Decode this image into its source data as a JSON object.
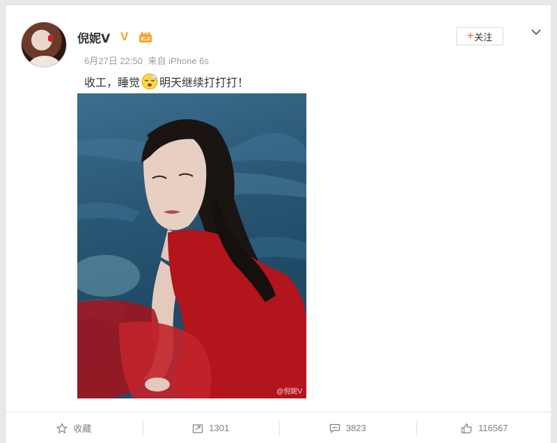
{
  "post": {
    "username": "倪妮V",
    "verified_badge": "V",
    "member_icon": "vip-crown-icon",
    "date": "6月27日 22:50",
    "source": "来自 iPhone 6s",
    "text_before_emoji": "收工，睡觉",
    "emoji": "sleepy-face-emoji",
    "text_after_emoji": "明天继续打打打！",
    "follow_label": "关注",
    "photo_watermark": "@倪妮V",
    "colors": {
      "accent": "#ff8140",
      "verified": "#f7a51c",
      "dress": "#b3151c",
      "water": "#2a5775"
    }
  },
  "actions": {
    "favorite": {
      "icon": "star-icon",
      "label": "收藏"
    },
    "repost": {
      "icon": "repost-icon",
      "count": "1301"
    },
    "comment": {
      "icon": "comment-icon",
      "count": "3823"
    },
    "like": {
      "icon": "thumbs-up-icon",
      "count": "116567"
    }
  }
}
